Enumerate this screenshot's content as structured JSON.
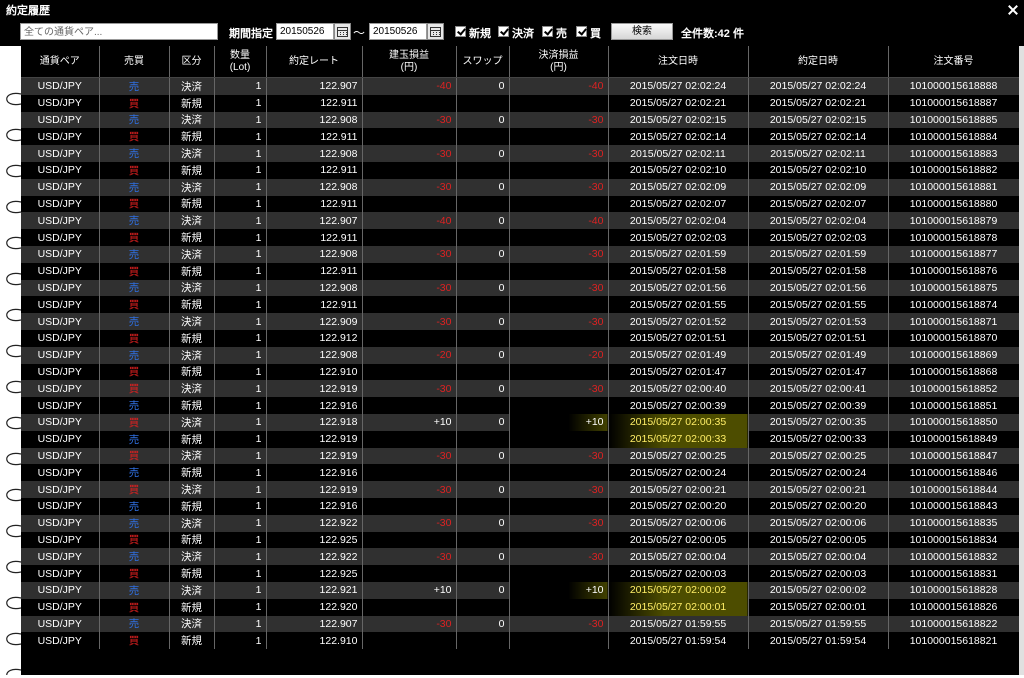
{
  "window": {
    "title": "約定履歴"
  },
  "toolbar": {
    "pair_select": "全ての通貨ペア...",
    "period_label": "期間指定",
    "date_from": "20150526",
    "tilde": "〜",
    "date_to": "20150526",
    "filters": [
      {
        "label": "新規",
        "checked": true
      },
      {
        "label": "決済",
        "checked": true
      },
      {
        "label": "売",
        "checked": true
      },
      {
        "label": "買",
        "checked": true
      }
    ],
    "search_label": "検索",
    "total": "全件数:42 件"
  },
  "table": {
    "headers": [
      "通貨ペア",
      "売買",
      "区分",
      "数量\n(Lot)",
      "約定レート",
      "建玉損益\n(円)",
      "スワップ",
      "決済損益\n(円)",
      "注文日時",
      "約定日時",
      "注文番号"
    ],
    "rows": [
      [
        "USD/JPY",
        "売",
        "決済",
        "1",
        "122.907",
        "-40",
        "0",
        "-40",
        "2015/05/27 02:02:24",
        "2015/05/27 02:02:24",
        "101000015618888"
      ],
      [
        "USD/JPY",
        "買",
        "新規",
        "1",
        "122.911",
        "",
        "",
        "",
        "2015/05/27 02:02:21",
        "2015/05/27 02:02:21",
        "101000015618887"
      ],
      [
        "USD/JPY",
        "売",
        "決済",
        "1",
        "122.908",
        "-30",
        "0",
        "-30",
        "2015/05/27 02:02:15",
        "2015/05/27 02:02:15",
        "101000015618885"
      ],
      [
        "USD/JPY",
        "買",
        "新規",
        "1",
        "122.911",
        "",
        "",
        "",
        "2015/05/27 02:02:14",
        "2015/05/27 02:02:14",
        "101000015618884"
      ],
      [
        "USD/JPY",
        "売",
        "決済",
        "1",
        "122.908",
        "-30",
        "0",
        "-30",
        "2015/05/27 02:02:11",
        "2015/05/27 02:02:11",
        "101000015618883"
      ],
      [
        "USD/JPY",
        "買",
        "新規",
        "1",
        "122.911",
        "",
        "",
        "",
        "2015/05/27 02:02:10",
        "2015/05/27 02:02:10",
        "101000015618882"
      ],
      [
        "USD/JPY",
        "売",
        "決済",
        "1",
        "122.908",
        "-30",
        "0",
        "-30",
        "2015/05/27 02:02:09",
        "2015/05/27 02:02:09",
        "101000015618881"
      ],
      [
        "USD/JPY",
        "買",
        "新規",
        "1",
        "122.911",
        "",
        "",
        "",
        "2015/05/27 02:02:07",
        "2015/05/27 02:02:07",
        "101000015618880"
      ],
      [
        "USD/JPY",
        "売",
        "決済",
        "1",
        "122.907",
        "-40",
        "0",
        "-40",
        "2015/05/27 02:02:04",
        "2015/05/27 02:02:04",
        "101000015618879"
      ],
      [
        "USD/JPY",
        "買",
        "新規",
        "1",
        "122.911",
        "",
        "",
        "",
        "2015/05/27 02:02:03",
        "2015/05/27 02:02:03",
        "101000015618878"
      ],
      [
        "USD/JPY",
        "売",
        "決済",
        "1",
        "122.908",
        "-30",
        "0",
        "-30",
        "2015/05/27 02:01:59",
        "2015/05/27 02:01:59",
        "101000015618877"
      ],
      [
        "USD/JPY",
        "買",
        "新規",
        "1",
        "122.911",
        "",
        "",
        "",
        "2015/05/27 02:01:58",
        "2015/05/27 02:01:58",
        "101000015618876"
      ],
      [
        "USD/JPY",
        "売",
        "決済",
        "1",
        "122.908",
        "-30",
        "0",
        "-30",
        "2015/05/27 02:01:56",
        "2015/05/27 02:01:56",
        "101000015618875"
      ],
      [
        "USD/JPY",
        "買",
        "新規",
        "1",
        "122.911",
        "",
        "",
        "",
        "2015/05/27 02:01:55",
        "2015/05/27 02:01:55",
        "101000015618874"
      ],
      [
        "USD/JPY",
        "売",
        "決済",
        "1",
        "122.909",
        "-30",
        "0",
        "-30",
        "2015/05/27 02:01:52",
        "2015/05/27 02:01:53",
        "101000015618871"
      ],
      [
        "USD/JPY",
        "買",
        "新規",
        "1",
        "122.912",
        "",
        "",
        "",
        "2015/05/27 02:01:51",
        "2015/05/27 02:01:51",
        "101000015618870"
      ],
      [
        "USD/JPY",
        "売",
        "決済",
        "1",
        "122.908",
        "-20",
        "0",
        "-20",
        "2015/05/27 02:01:49",
        "2015/05/27 02:01:49",
        "101000015618869"
      ],
      [
        "USD/JPY",
        "買",
        "新規",
        "1",
        "122.910",
        "",
        "",
        "",
        "2015/05/27 02:01:47",
        "2015/05/27 02:01:47",
        "101000015618868"
      ],
      [
        "USD/JPY",
        "買",
        "決済",
        "1",
        "122.919",
        "-30",
        "0",
        "-30",
        "2015/05/27 02:00:40",
        "2015/05/27 02:00:41",
        "101000015618852"
      ],
      [
        "USD/JPY",
        "売",
        "新規",
        "1",
        "122.916",
        "",
        "",
        "",
        "2015/05/27 02:00:39",
        "2015/05/27 02:00:39",
        "101000015618851"
      ],
      [
        "USD/JPY",
        "買",
        "決済",
        "1",
        "122.918",
        "+10",
        "0",
        "+10",
        "2015/05/27 02:00:35",
        "2015/05/27 02:00:35",
        "101000015618850"
      ],
      [
        "USD/JPY",
        "売",
        "新規",
        "1",
        "122.919",
        "",
        "",
        "",
        "2015/05/27 02:00:33",
        "2015/05/27 02:00:33",
        "101000015618849"
      ],
      [
        "USD/JPY",
        "買",
        "決済",
        "1",
        "122.919",
        "-30",
        "0",
        "-30",
        "2015/05/27 02:00:25",
        "2015/05/27 02:00:25",
        "101000015618847"
      ],
      [
        "USD/JPY",
        "売",
        "新規",
        "1",
        "122.916",
        "",
        "",
        "",
        "2015/05/27 02:00:24",
        "2015/05/27 02:00:24",
        "101000015618846"
      ],
      [
        "USD/JPY",
        "買",
        "決済",
        "1",
        "122.919",
        "-30",
        "0",
        "-30",
        "2015/05/27 02:00:21",
        "2015/05/27 02:00:21",
        "101000015618844"
      ],
      [
        "USD/JPY",
        "売",
        "新規",
        "1",
        "122.916",
        "",
        "",
        "",
        "2015/05/27 02:00:20",
        "2015/05/27 02:00:20",
        "101000015618843"
      ],
      [
        "USD/JPY",
        "売",
        "決済",
        "1",
        "122.922",
        "-30",
        "0",
        "-30",
        "2015/05/27 02:00:06",
        "2015/05/27 02:00:06",
        "101000015618835"
      ],
      [
        "USD/JPY",
        "買",
        "新規",
        "1",
        "122.925",
        "",
        "",
        "",
        "2015/05/27 02:00:05",
        "2015/05/27 02:00:05",
        "101000015618834"
      ],
      [
        "USD/JPY",
        "売",
        "決済",
        "1",
        "122.922",
        "-30",
        "0",
        "-30",
        "2015/05/27 02:00:04",
        "2015/05/27 02:00:04",
        "101000015618832"
      ],
      [
        "USD/JPY",
        "買",
        "新規",
        "1",
        "122.925",
        "",
        "",
        "",
        "2015/05/27 02:00:03",
        "2015/05/27 02:00:03",
        "101000015618831"
      ],
      [
        "USD/JPY",
        "売",
        "決済",
        "1",
        "122.921",
        "+10",
        "0",
        "+10",
        "2015/05/27 02:00:02",
        "2015/05/27 02:00:02",
        "101000015618828"
      ],
      [
        "USD/JPY",
        "買",
        "新規",
        "1",
        "122.920",
        "",
        "",
        "",
        "2015/05/27 02:00:01",
        "2015/05/27 02:00:01",
        "101000015618826"
      ],
      [
        "USD/JPY",
        "売",
        "決済",
        "1",
        "122.907",
        "-30",
        "0",
        "-30",
        "2015/05/27 01:59:55",
        "2015/05/27 01:59:55",
        "101000015618822"
      ],
      [
        "USD/JPY",
        "買",
        "新規",
        "1",
        "122.910",
        "",
        "",
        "",
        "2015/05/27 01:59:54",
        "2015/05/27 01:59:54",
        "101000015618821"
      ]
    ],
    "highlighted_rows": [
      20,
      21,
      30,
      31
    ]
  },
  "colors": {
    "sell": "#2f6fe0",
    "buy": "#e02020",
    "loss": "#d22222",
    "highlight": "#ffee66",
    "row_odd": "#303030",
    "row_even": "#000000"
  }
}
